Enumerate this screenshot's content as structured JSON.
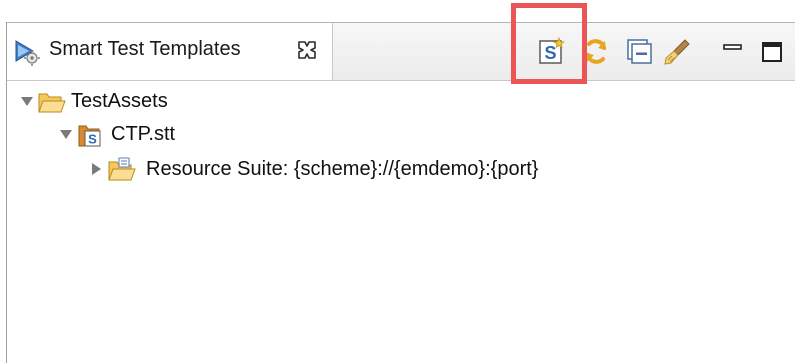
{
  "view": {
    "tab_label": "Smart Test Templates",
    "toolbar": [
      {
        "name": "new-template-icon"
      },
      {
        "name": "refresh-icon"
      },
      {
        "name": "collapse-all-icon"
      },
      {
        "name": "clear-icon"
      },
      {
        "name": "minimize-icon"
      },
      {
        "name": "maximize-icon"
      }
    ]
  },
  "tree": {
    "root": {
      "label": "TestAssets",
      "expanded": true
    },
    "child": {
      "label": "CTP.stt",
      "expanded": true
    },
    "grandchild": {
      "label": "Resource Suite: {scheme}://{emdemo}:{port}",
      "expanded": false
    }
  },
  "colors": {
    "highlight": "#ea5555",
    "folder": "#f2b33d",
    "file_blue": "#3a6ea8"
  }
}
